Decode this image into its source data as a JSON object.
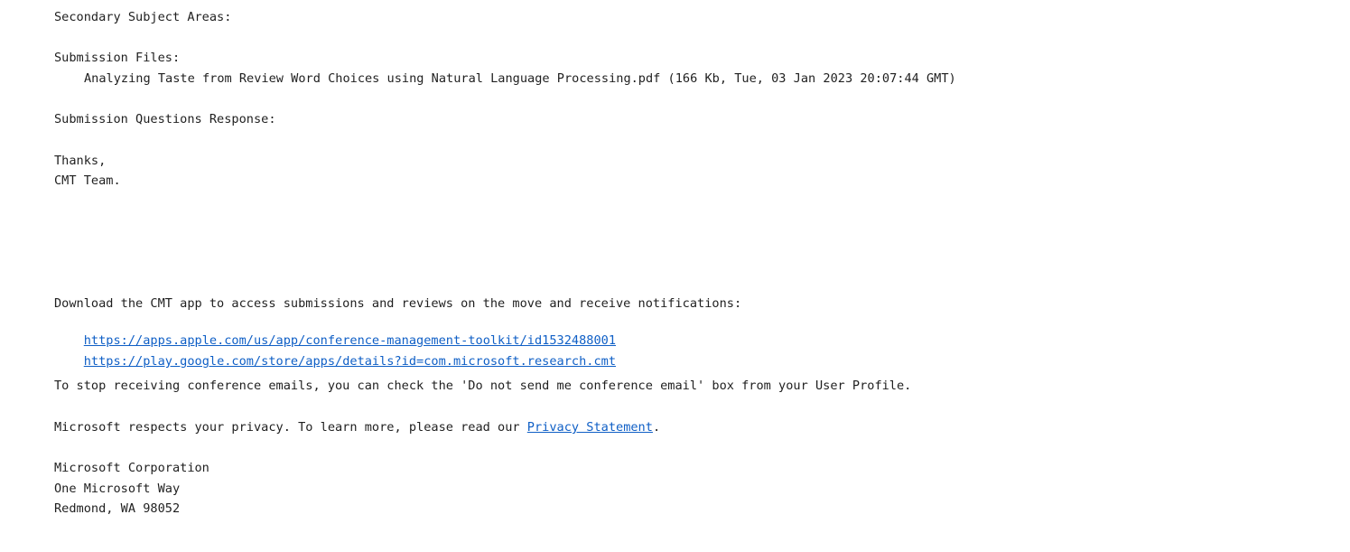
{
  "email": {
    "secondary_subject_areas_label": "Secondary Subject Areas:",
    "submission_files_label": "Submission Files:",
    "submission_file_entry": "Analyzing Taste from Review Word Choices using Natural Language Processing.pdf (166 Kb, Tue, 03 Jan 2023 20:07:44 GMT)",
    "submission_questions_label": "Submission Questions Response:",
    "closing": "Thanks,",
    "signature": "CMT Team."
  },
  "footer": {
    "app_text": "Download the CMT app to access submissions and reviews on the move and receive notifications:",
    "apple_link": "https://apps.apple.com/us/app/conference-management-toolkit/id1532488001",
    "google_link": "https://play.google.com/store/apps/details?id=com.microsoft.research.cmt",
    "unsubscribe_text": "To stop receiving conference emails, you can check the 'Do not send me conference email' box from your User Profile.",
    "privacy_prefix": "Microsoft respects your privacy. To learn more, please read our ",
    "privacy_link": "Privacy Statement",
    "privacy_suffix": ".",
    "company": "Microsoft Corporation",
    "street": "One Microsoft Way",
    "city": "Redmond, WA 98052"
  },
  "colors": {
    "text": "#1f1f1f",
    "link": "#0f5fc6"
  }
}
